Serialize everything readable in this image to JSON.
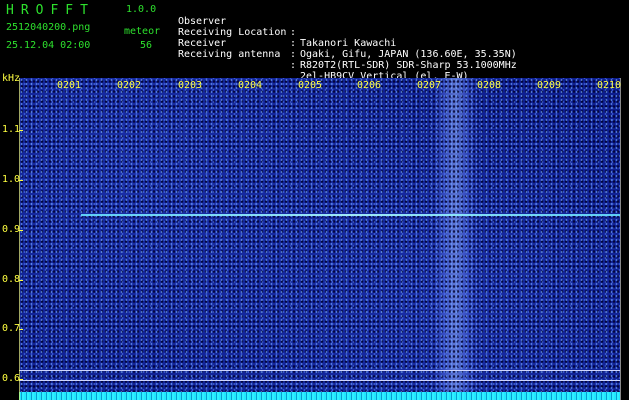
{
  "header": {
    "app_title": "HROFFT",
    "app_version": "1.0.0",
    "filename": "2512040200.png",
    "datetime": "25.12.04 02:00",
    "meteor_label": "meteor",
    "meteor_count": "56",
    "rows": [
      {
        "label": "Observer",
        "value": "Takanori Kawachi"
      },
      {
        "label": "Receiving Location",
        "value": "Ogaki, Gifu, JAPAN (136.60E, 35.35N)"
      },
      {
        "label": "Receiver",
        "value": "R820T2(RTL-SDR) SDR-Sharp 53.1000MHz"
      },
      {
        "label": "Receiving antenna",
        "value": "2el-HB9CV Vertical (el. E-W)"
      }
    ]
  },
  "axis": {
    "unit": "kHz",
    "x_ticks": [
      "0201",
      "0202",
      "0203",
      "0204",
      "0205",
      "0206",
      "0207",
      "0208",
      "0209",
      "0210"
    ],
    "y_ticks": [
      "1.1",
      "1.0",
      "0.9",
      "0.8",
      "0.7",
      "0.6"
    ]
  },
  "colors": {
    "text_green": "#2de02d",
    "axis_yellow": "#ffff40",
    "background_blue": "#0c1c8c",
    "carrier_cyan": "#aefcff"
  }
}
